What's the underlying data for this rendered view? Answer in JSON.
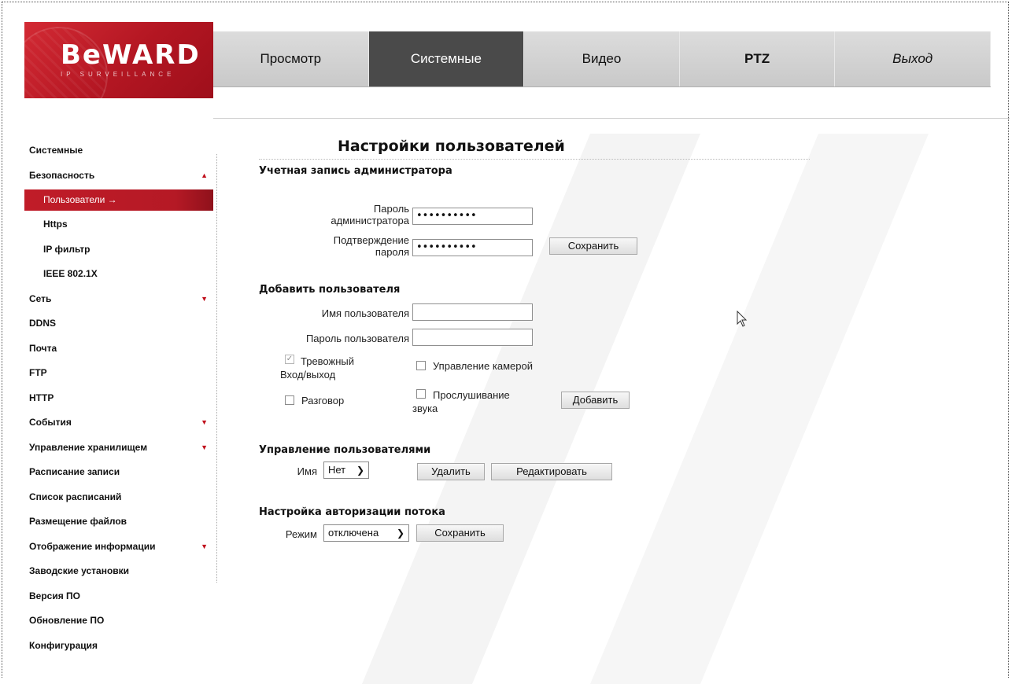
{
  "header": {
    "logo_text": "BeWARD",
    "logo_tagline": "IP SURVEILLANCE",
    "nav": [
      {
        "label": "Просмотр"
      },
      {
        "label": "Системные"
      },
      {
        "label": "Видео"
      },
      {
        "label": "PTZ"
      },
      {
        "label": "Выход"
      }
    ]
  },
  "sidebar": {
    "items": [
      {
        "label": "Системные"
      },
      {
        "label": "Безопасность"
      },
      {
        "label": "Пользователи →"
      },
      {
        "label": "Https"
      },
      {
        "label": "IP фильтр"
      },
      {
        "label": "IEEE 802.1X"
      },
      {
        "label": "Сеть"
      },
      {
        "label": "DDNS"
      },
      {
        "label": "Почта"
      },
      {
        "label": "FTP"
      },
      {
        "label": "HTTP"
      },
      {
        "label": "События"
      },
      {
        "label": "Управление хранилищем"
      },
      {
        "label": "Расписание записи"
      },
      {
        "label": "Список расписаний"
      },
      {
        "label": "Размещение файлов"
      },
      {
        "label": "Отображение информации"
      },
      {
        "label": "Заводские установки"
      },
      {
        "label": "Версия ПО"
      },
      {
        "label": "Обновление ПО"
      },
      {
        "label": "Конфигурация"
      }
    ],
    "arrow_up": "▲",
    "arrow_down": "▼"
  },
  "main": {
    "title": "Настройки пользователей",
    "admin": {
      "section": "Учетная запись администратора",
      "password_label": "Пароль администратора",
      "password_value": "••••••••••",
      "confirm_label": "Подтверждение пароля",
      "confirm_value": "••••••••••",
      "save_label": "Сохранить"
    },
    "add_user": {
      "section": "Добавить пользователя",
      "username_label": "Имя пользователя",
      "username_value": "",
      "password_label": "Пароль пользователя",
      "password_value": "",
      "alarm_io_label": "Тревожный Вход/выход",
      "camera_control_label": "Управление камерой",
      "talk_label": "Разговор",
      "listen_label": "Прослушивание звука",
      "add_label": "Добавить",
      "alarm_io_checked": true,
      "camera_control_checked": false,
      "talk_checked": false,
      "listen_checked": false
    },
    "manage": {
      "section": "Управление пользователями",
      "name_label": "Имя",
      "name_selected": "Нет",
      "delete_label": "Удалить",
      "edit_label": "Редактировать"
    },
    "stream_auth": {
      "section": "Настройка авторизации потока",
      "mode_label": "Режим",
      "mode_selected": "отключена",
      "save_label": "Сохранить"
    }
  },
  "colors": {
    "accent_red": "#c01c28",
    "nav_active": "#4a4a4a",
    "nav_bg": "#d3d3d3"
  }
}
